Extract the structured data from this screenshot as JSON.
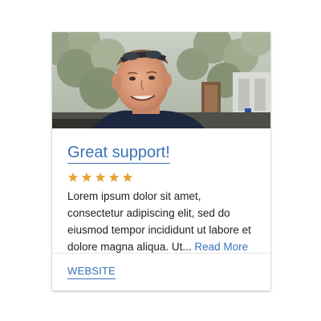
{
  "review": {
    "title": "Great support!",
    "rating": 5,
    "max_rating": 5,
    "star_color": "#e5a532",
    "excerpt": "Lorem ipsum dolor sit amet, consectetur adipiscing elit, sed do eiusmod tempor incididunt ut labore et dolore magna aliqua. Ut...",
    "read_more_label": "Read More",
    "website_label": "WEBSITE"
  },
  "colors": {
    "link": "#3a72b8",
    "text": "#222222"
  }
}
